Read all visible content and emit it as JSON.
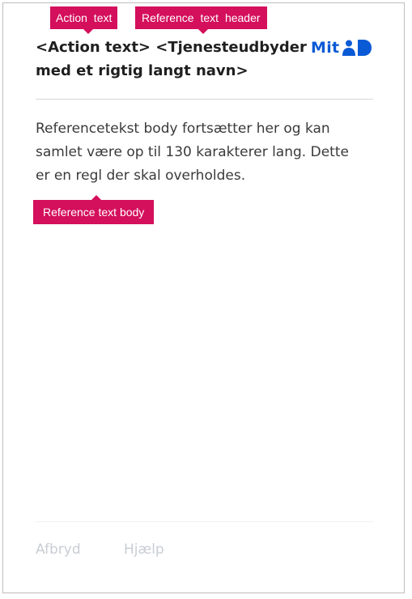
{
  "header": {
    "title_line1": "<Action text> <Tjenesteudbyder",
    "title_line2": "med et rigtig langt navn>"
  },
  "logo": {
    "text": "Mit",
    "mark_icon": "mitid-person-icon",
    "brand_color": "#0a5ad6"
  },
  "body": {
    "line1": "Referencetekst body fortsætter her og kan",
    "line2": "samlet være op til 130 karakterer lang. Dette",
    "line3": "er en regl der skal overholdes."
  },
  "footer": {
    "cancel_label": "Afbryd",
    "help_label": "Hjælp"
  },
  "annotations": {
    "action_text": "Action text",
    "reference_header": "Reference text header",
    "reference_body": "Reference text body",
    "tag_color": "#d40f5c"
  }
}
